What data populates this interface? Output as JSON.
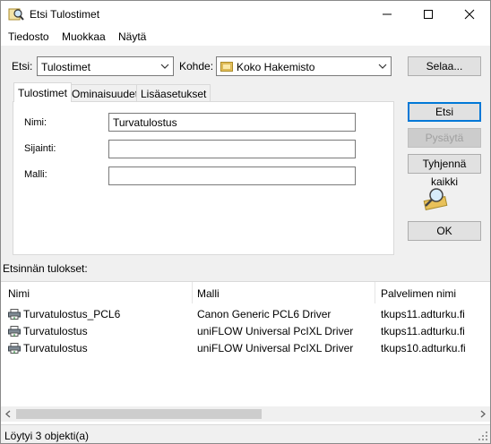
{
  "window": {
    "title": "Etsi Tulostimet"
  },
  "menu": {
    "items": [
      "Tiedosto",
      "Muokkaa",
      "Näytä"
    ]
  },
  "search": {
    "find_label": "Etsi:",
    "find_value": "Tulostimet",
    "in_label": "Kohde:",
    "in_value": "Koko Hakemisto",
    "browse_label": "Selaa..."
  },
  "tabs": [
    "Tulostimet",
    "Ominaisuudet",
    "Lisäasetukset"
  ],
  "form": {
    "name_label": "Nimi:",
    "name_value": "Turvatulostus",
    "location_label": "Sijainti:",
    "location_value": "",
    "model_label": "Malli:",
    "model_value": ""
  },
  "buttons": {
    "find_now": "Etsi",
    "stop": "Pysäytä",
    "clear_all": "Tyhjennä kaikki",
    "ok": "OK"
  },
  "results": {
    "label": "Etsinnän tulokset:",
    "columns": [
      "Nimi",
      "Malli",
      "Palvelimen nimi"
    ],
    "rows": [
      {
        "name": "Turvatulostus_PCL6",
        "model": "Canon Generic PCL6 Driver",
        "server": "tkups11.adturku.fi"
      },
      {
        "name": "Turvatulostus",
        "model": "uniFLOW Universal PcIXL Driver",
        "server": "tkups11.adturku.fi"
      },
      {
        "name": "Turvatulostus",
        "model": "uniFLOW Universal PcIXL Driver",
        "server": "tkups10.adturku.fi"
      }
    ]
  },
  "status": {
    "text": "Löytyi 3 objekti(a)"
  },
  "icons": {
    "title": "search-printers-icon",
    "folder": "directory-icon",
    "printer": "printer-icon",
    "animation": "magnifier-icon"
  },
  "colors": {
    "accent": "#0078d7",
    "folder": "#e8c15a"
  }
}
